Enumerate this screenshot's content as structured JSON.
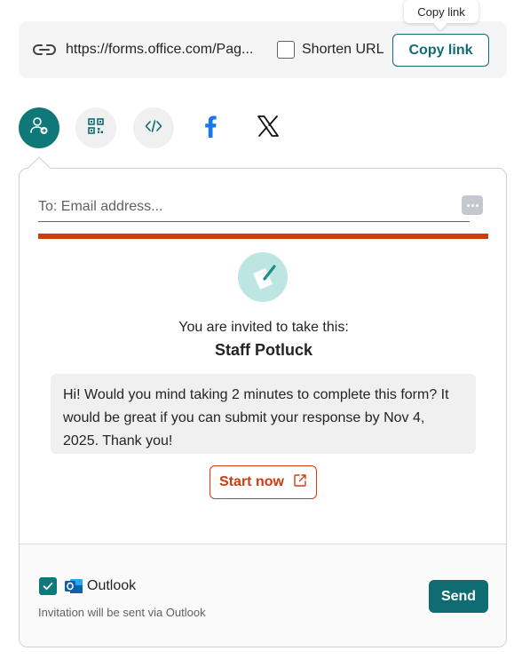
{
  "tooltip": {
    "text": "Copy link"
  },
  "link_bar": {
    "url": "https://forms.office.com/Pag...",
    "shorten_label": "Shorten URL",
    "shorten_checked": false,
    "copy_button": "Copy link"
  },
  "share_options": [
    {
      "name": "email",
      "icon": "email-share-icon",
      "selected": true
    },
    {
      "name": "qr-code",
      "icon": "qr-code-icon",
      "selected": false
    },
    {
      "name": "embed",
      "icon": "embed-code-icon",
      "selected": false
    },
    {
      "name": "facebook",
      "icon": "facebook-icon",
      "selected": false
    },
    {
      "name": "x",
      "icon": "x-icon",
      "selected": false
    }
  ],
  "email_panel": {
    "to_placeholder": "To: Email address...",
    "invite_line": "You are invited to take this:",
    "form_title": "Staff Potluck",
    "message": "Hi! Would you mind taking 2 minutes to complete this form? It would be great if you can submit your response by Nov 4, 2025. Thank you!",
    "start_button": "Start now",
    "outlook_label": "Outlook",
    "outlook_checked": true,
    "outlook_note": "Invitation will be sent via Outlook",
    "send_button": "Send"
  },
  "colors": {
    "accent_teal": "#0f6c73",
    "theme_orange": "#d03b0f",
    "logo_bg": "#bde5e1"
  }
}
